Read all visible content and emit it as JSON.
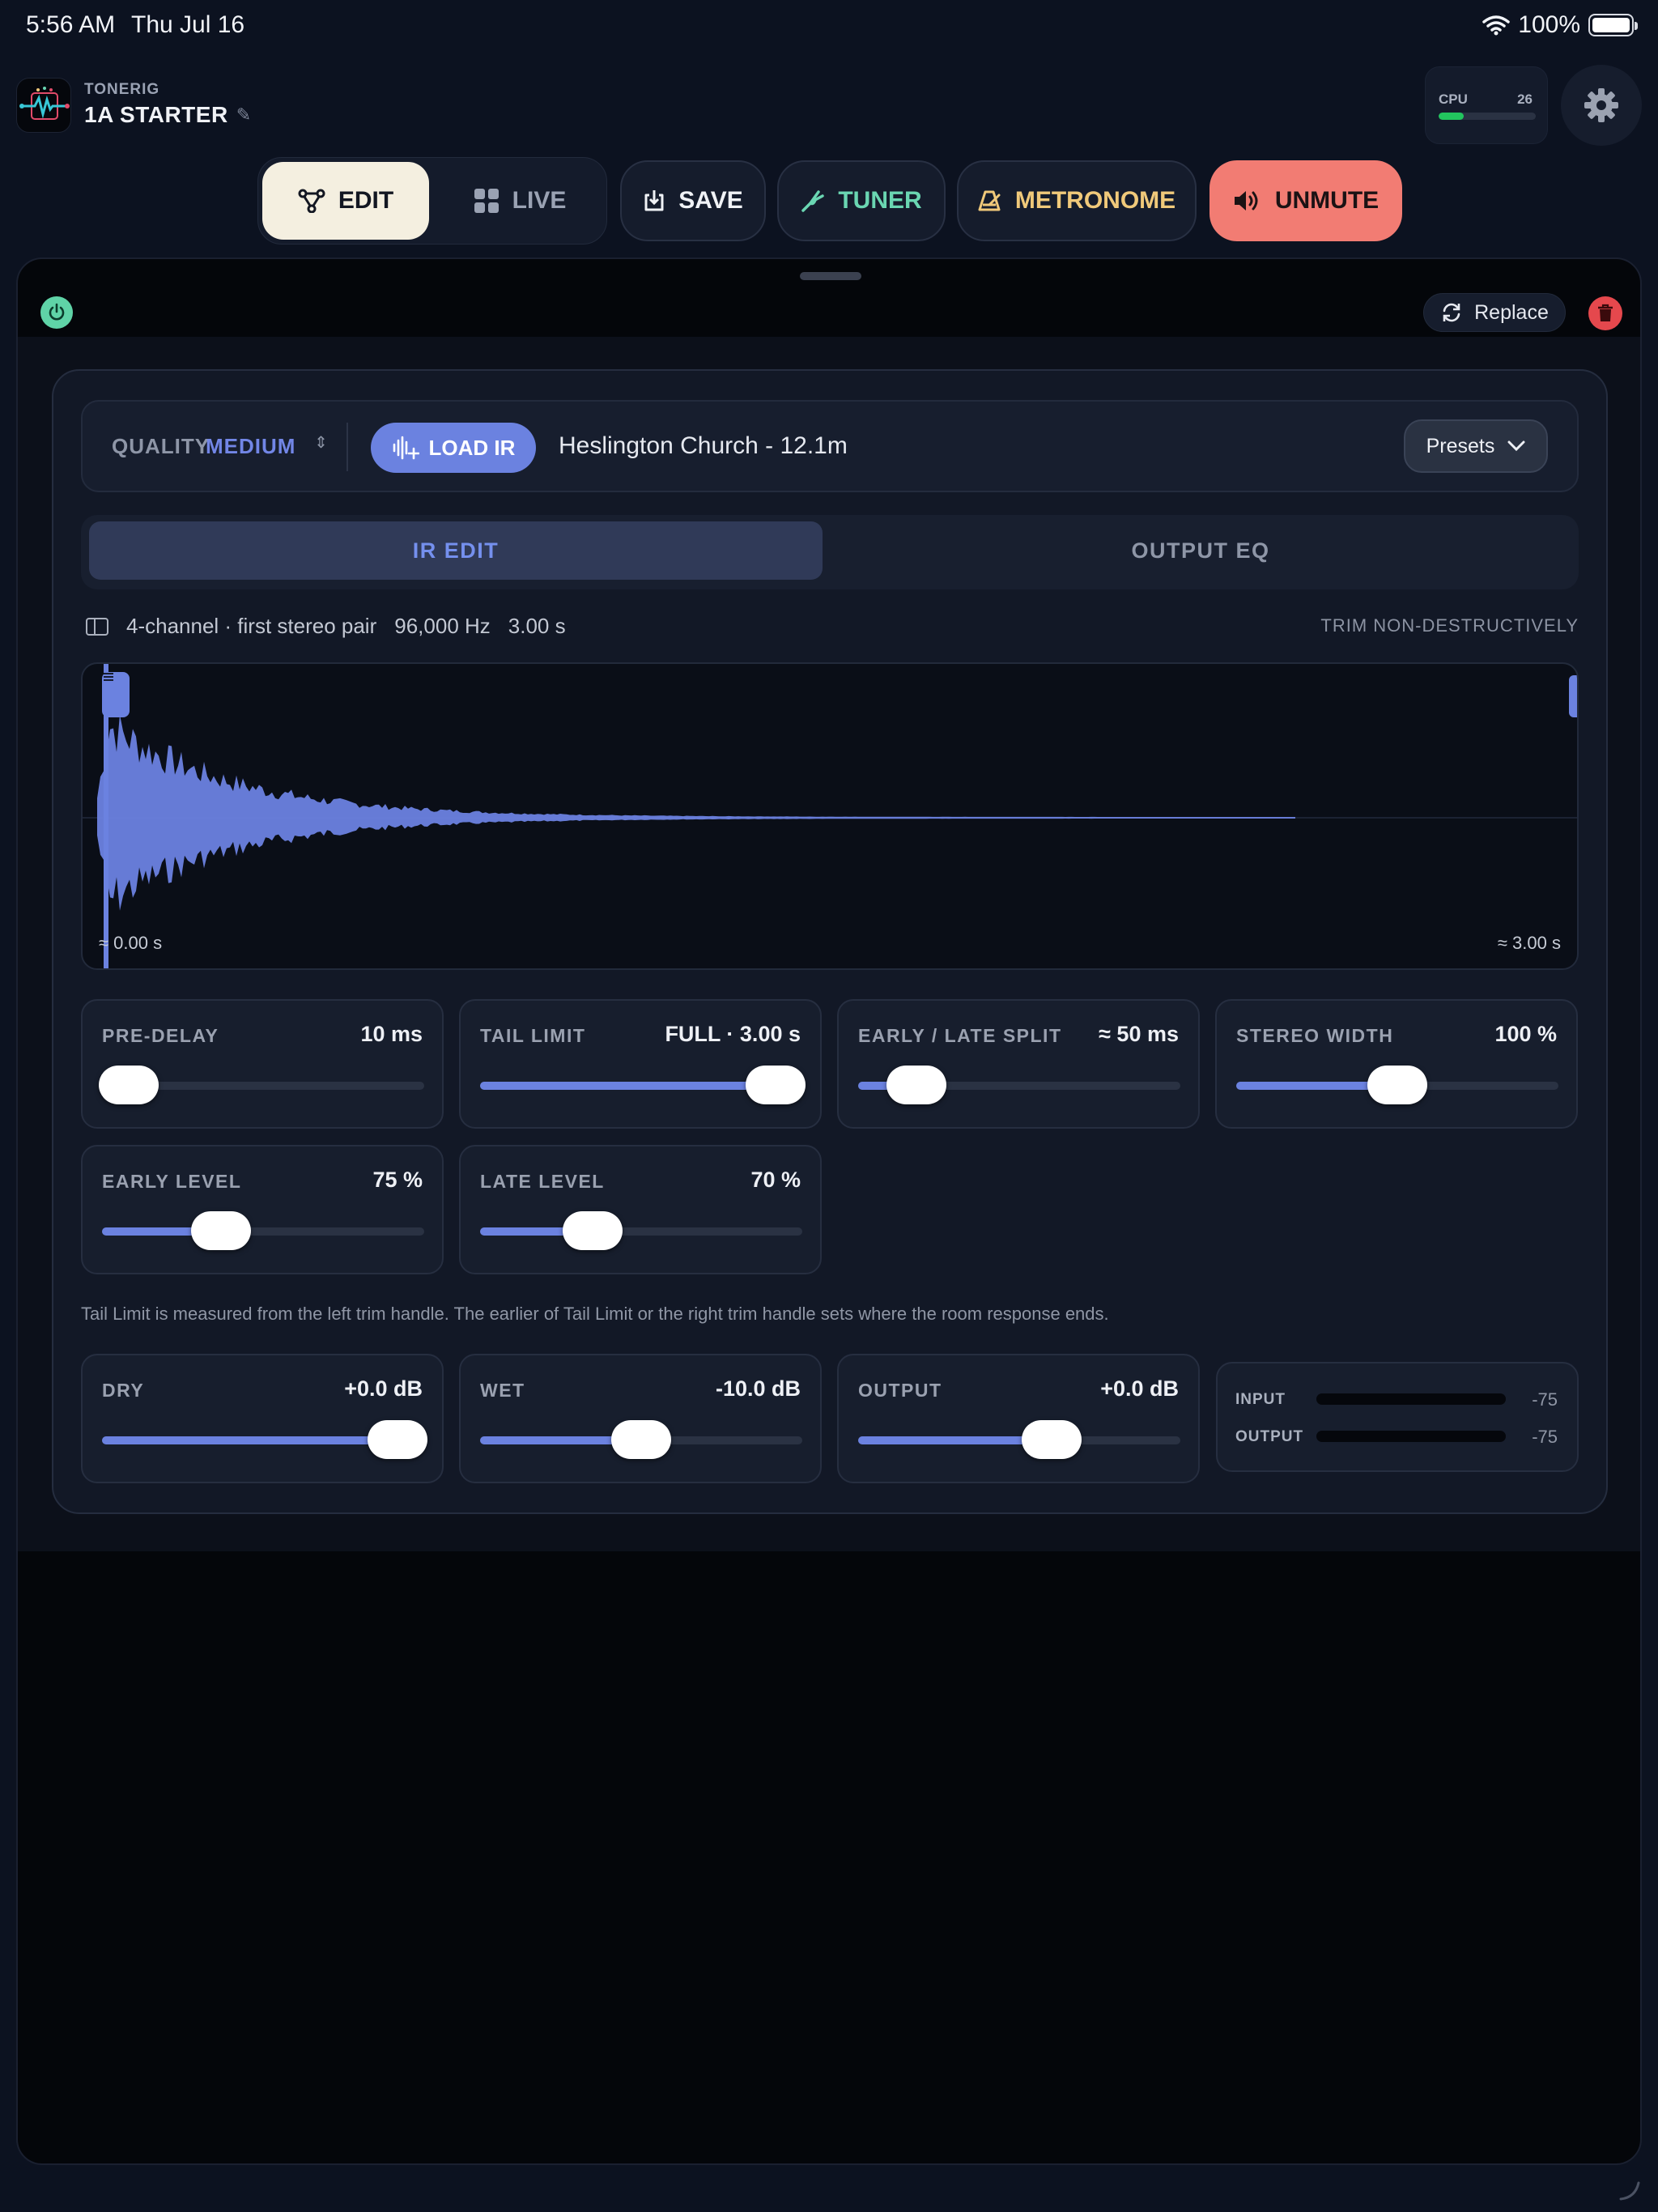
{
  "status_bar": {
    "time": "5:56 AM",
    "date": "Thu Jul 16",
    "battery": "100%"
  },
  "header": {
    "brand": "TONERIG",
    "preset_name": "1A STARTER",
    "cpu": {
      "label": "CPU",
      "value": "26",
      "percent": 26
    }
  },
  "toolbar": {
    "edit_label": "EDIT",
    "live_label": "LIVE",
    "save_label": "SAVE",
    "tuner_label": "TUNER",
    "metronome_label": "METRONOME",
    "unmute_label": "UNMUTE"
  },
  "block": {
    "replace_label": "Replace",
    "quality_label": "QUALITY",
    "quality_value": "MEDIUM",
    "load_ir_label": "LOAD IR",
    "ir_name": "Heslington Church - 12.1m",
    "presets_label": "Presets",
    "tabs": [
      {
        "label": "IR EDIT",
        "active": true
      },
      {
        "label": "OUTPUT EQ",
        "active": false
      }
    ],
    "info": {
      "channels": "4-channel · first stereo pair",
      "rate": "96,000 Hz",
      "length": "3.00 s"
    },
    "trim_label": "TRIM NON-DESTRUCTIVELY",
    "waveform": {
      "start_label": "≈ 0.00 s",
      "end_label": "≈ 3.00 s"
    },
    "sliders": [
      {
        "label": "PRE-DELAY",
        "value": "10 ms",
        "fraction": 0.05
      },
      {
        "label": "TAIL LIMIT",
        "value": "FULL · 3.00 s",
        "fraction": 1.0
      },
      {
        "label": "EARLY / LATE SPLIT",
        "value": "≈ 50 ms",
        "fraction": 0.18
      },
      {
        "label": "STEREO WIDTH",
        "value": "100 %",
        "fraction": 0.5
      },
      {
        "label": "EARLY LEVEL",
        "value": "75 %",
        "fraction": 0.37
      },
      {
        "label": "LATE LEVEL",
        "value": "70 %",
        "fraction": 0.35
      }
    ],
    "note": "Tail Limit is measured from the left trim handle. The earlier of Tail Limit or the right trim handle sets where the room response ends.",
    "mix_sliders": [
      {
        "label": "DRY",
        "value": "+0.0 dB",
        "fraction": 1.0
      },
      {
        "label": "WET",
        "value": "-10.0 dB",
        "fraction": 0.5
      },
      {
        "label": "OUTPUT",
        "value": "+0.0 dB",
        "fraction": 0.6
      }
    ],
    "meters": [
      {
        "label": "INPUT",
        "value": "-75"
      },
      {
        "label": "OUTPUT",
        "value": "-75"
      }
    ]
  },
  "colors": {
    "accent": "#6b82e0",
    "unmute": "#f27c73",
    "tuner": "#6ad6b2",
    "metronome": "#f0c97a",
    "power": "#5fd3a7",
    "delete": "#e5484d"
  }
}
